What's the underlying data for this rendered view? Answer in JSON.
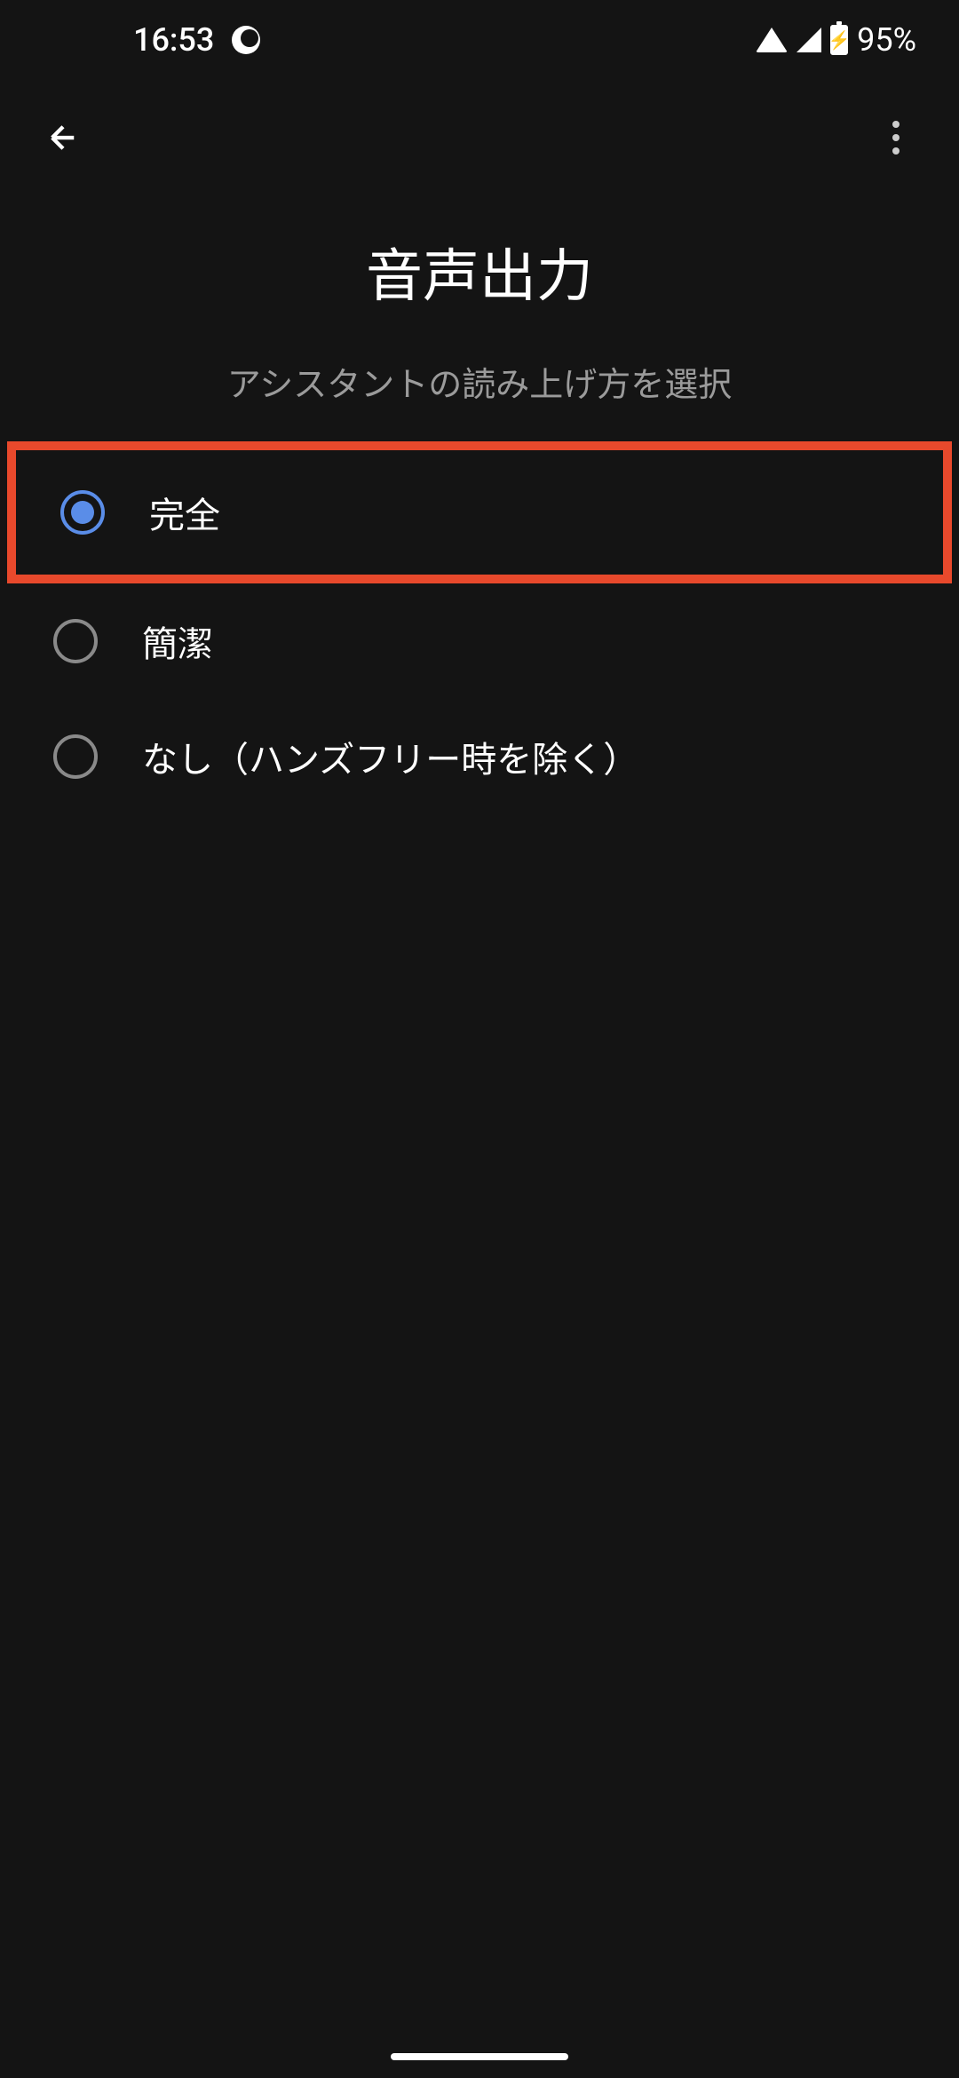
{
  "status_bar": {
    "time": "16:53",
    "battery_percent": "95%"
  },
  "header": {
    "title": "音声出力",
    "subtitle": "アシスタントの読み上げ方を選択"
  },
  "options": [
    {
      "label": "完全",
      "selected": true,
      "highlighted": true
    },
    {
      "label": "簡潔",
      "selected": false,
      "highlighted": false
    },
    {
      "label": "なし（ハンズフリー時を除く）",
      "selected": false,
      "highlighted": false
    }
  ],
  "colors": {
    "background": "#141414",
    "accent": "#5a8de8",
    "highlight": "#e8492c",
    "text_secondary": "#9b9b9b"
  }
}
